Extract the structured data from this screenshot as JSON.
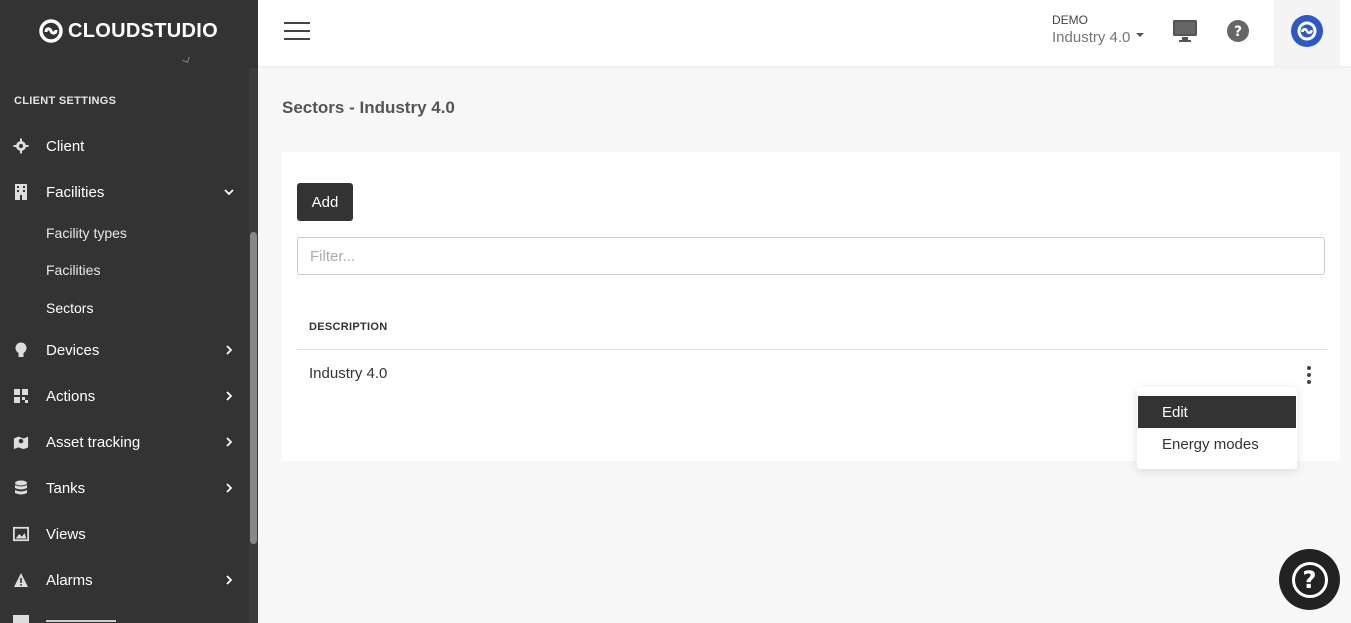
{
  "brand": {
    "name": "CLOUDSTUDIO"
  },
  "sidebar": {
    "section_title": "CLIENT SETTINGS",
    "items": [
      {
        "label": "Client",
        "icon": "gear-icon"
      },
      {
        "label": "Facilities",
        "icon": "building-icon",
        "expanded": true
      },
      {
        "label": "Devices",
        "icon": "lightbulb-icon"
      },
      {
        "label": "Actions",
        "icon": "grid-icon"
      },
      {
        "label": "Asset tracking",
        "icon": "map-marker-icon"
      },
      {
        "label": "Tanks",
        "icon": "database-icon"
      },
      {
        "label": "Views",
        "icon": "image-icon"
      },
      {
        "label": "Alarms",
        "icon": "warning-icon"
      }
    ],
    "sub_items": [
      {
        "label": "Facility types"
      },
      {
        "label": "Facilities"
      },
      {
        "label": "Sectors",
        "active": true
      }
    ]
  },
  "topbar": {
    "tenant_label": "DEMO",
    "tenant_value": "Industry 4.0"
  },
  "main": {
    "page_title": "Sectors - Industry 4.0",
    "add_label": "Add",
    "filter_placeholder": "Filter...",
    "table": {
      "column_header": "DESCRIPTION",
      "rows": [
        {
          "description": "Industry 4.0"
        }
      ]
    }
  },
  "row_menu": {
    "items": [
      {
        "label": "Edit",
        "active": true
      },
      {
        "label": "Energy modes"
      }
    ]
  },
  "floating_help": {
    "label": "?"
  },
  "colors": {
    "sidebar_bg": "#333333",
    "accent_dark": "#333333",
    "avatar": "#2f58c4"
  }
}
